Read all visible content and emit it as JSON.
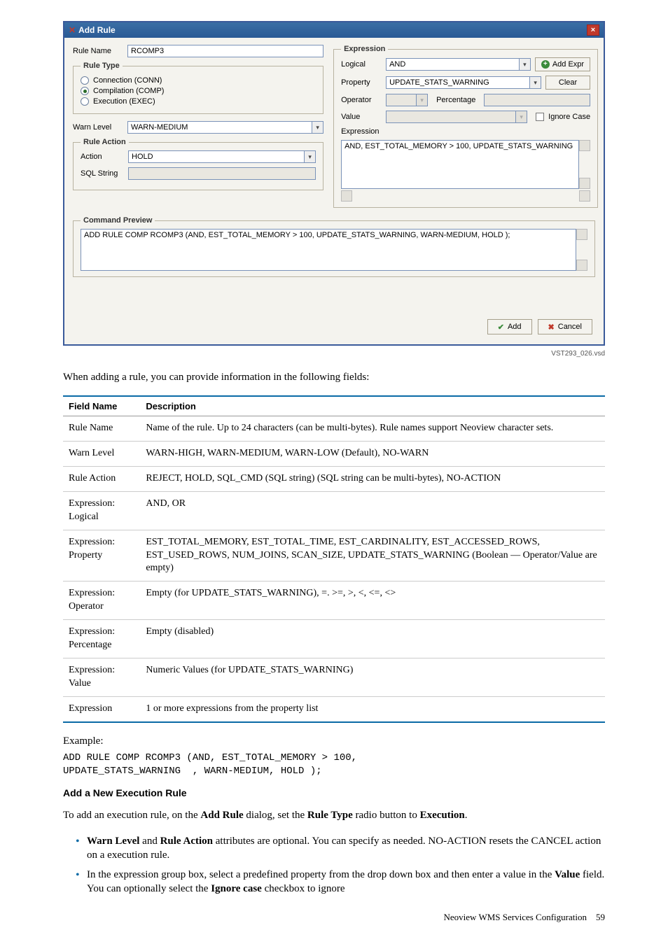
{
  "dialog": {
    "title": "Add Rule",
    "rule_name_label": "Rule Name",
    "rule_name_value": "RCOMP3",
    "rule_type_legend": "Rule Type",
    "rule_type_options": {
      "conn": "Connection (CONN)",
      "comp": "Compilation (COMP)",
      "exec": "Execution (EXEC)"
    },
    "warn_level_label": "Warn Level",
    "warn_level_value": "WARN-MEDIUM",
    "rule_action_legend": "Rule Action",
    "action_label": "Action",
    "action_value": "HOLD",
    "sql_string_label": "SQL String",
    "sql_string_value": "",
    "expression_legend": "Expression",
    "logical_label": "Logical",
    "logical_value": "AND",
    "add_expr_btn": "Add Expr",
    "property_label": "Property",
    "property_value": "UPDATE_STATS_WARNING",
    "clear_btn": "Clear",
    "operator_label": "Operator",
    "operator_value": "",
    "percentage_label": "Percentage",
    "percentage_value": "",
    "value_label": "Value",
    "value_value": "",
    "ignore_case_label": "Ignore Case",
    "expression_label": "Expression",
    "expression_text": "AND, EST_TOTAL_MEMORY > 100, UPDATE_STATS_WARNING",
    "command_preview_legend": "Command Preview",
    "command_preview_text": "ADD RULE COMP RCOMP3 (AND, EST_TOTAL_MEMORY > 100, UPDATE_STATS_WARNING, WARN-MEDIUM, HOLD );",
    "add_btn": "Add",
    "cancel_btn": "Cancel"
  },
  "visd": "VST293_026.vsd",
  "intro": "When adding a rule, you can provide information in the following fields:",
  "table": {
    "headers": {
      "c1": "Field Name",
      "c2": "Description"
    },
    "rows": [
      {
        "c1": "Rule Name",
        "c2": "Name of the rule. Up to 24 characters (can be multi-bytes). Rule names support Neoview character sets."
      },
      {
        "c1": "Warn Level",
        "c2": "WARN-HIGH, WARN-MEDIUM, WARN-LOW (Default), NO-WARN"
      },
      {
        "c1": "Rule Action",
        "c2": "REJECT, HOLD, SQL_CMD (SQL string) (SQL string can be multi-bytes), NO-ACTION"
      },
      {
        "c1": "Expression: Logical",
        "c2": "AND, OR"
      },
      {
        "c1": "Expression: Property",
        "c2": "EST_TOTAL_MEMORY, EST_TOTAL_TIME, EST_CARDINALITY, EST_ACCESSED_ROWS, EST_USED_ROWS, NUM_JOINS, SCAN_SIZE, UPDATE_STATS_WARNING (Boolean — Operator/Value are empty)"
      },
      {
        "c1": "Expression: Operator",
        "c2": "Empty (for UPDATE_STATS_WARNING), =. >=, >, <, <=, <>"
      },
      {
        "c1": "Expression: Percentage",
        "c2": "Empty (disabled)"
      },
      {
        "c1": "Expression: Value",
        "c2": "Numeric Values (for UPDATE_STATS_WARNING)"
      },
      {
        "c1": "Expression",
        "c2": "1 or more expressions from the property list"
      }
    ]
  },
  "example_label": "Example:",
  "example_code": "ADD RULE COMP RCOMP3 (AND, EST_TOTAL_MEMORY > 100,\nUPDATE_STATS_WARNING  , WARN-MEDIUM, HOLD );",
  "section": {
    "heading": "Add a New Execution Rule",
    "para_parts": {
      "p1a": "To add an execution rule, on the ",
      "p1b": "Add Rule",
      "p1c": " dialog, set the ",
      "p1d": "Rule Type",
      "p1e": " radio button to ",
      "p1f": "Execution",
      "p1g": "."
    },
    "bullets": [
      {
        "b1a": "Warn Level",
        "b1b": " and ",
        "b1c": "Rule Action",
        "b1d": " attributes are optional. You can specify as needed. NO-ACTION resets the CANCEL action on a execution rule."
      },
      {
        "b2a": "In the expression group box, select a predefined property from the drop down box and then enter a value in the ",
        "b2b": "Value",
        "b2c": " field. You can optionally select the ",
        "b2d": "Ignore case",
        "b2e": " checkbox to ignore"
      }
    ]
  },
  "footer": {
    "text": "Neoview WMS Services Configuration",
    "page": "59"
  }
}
